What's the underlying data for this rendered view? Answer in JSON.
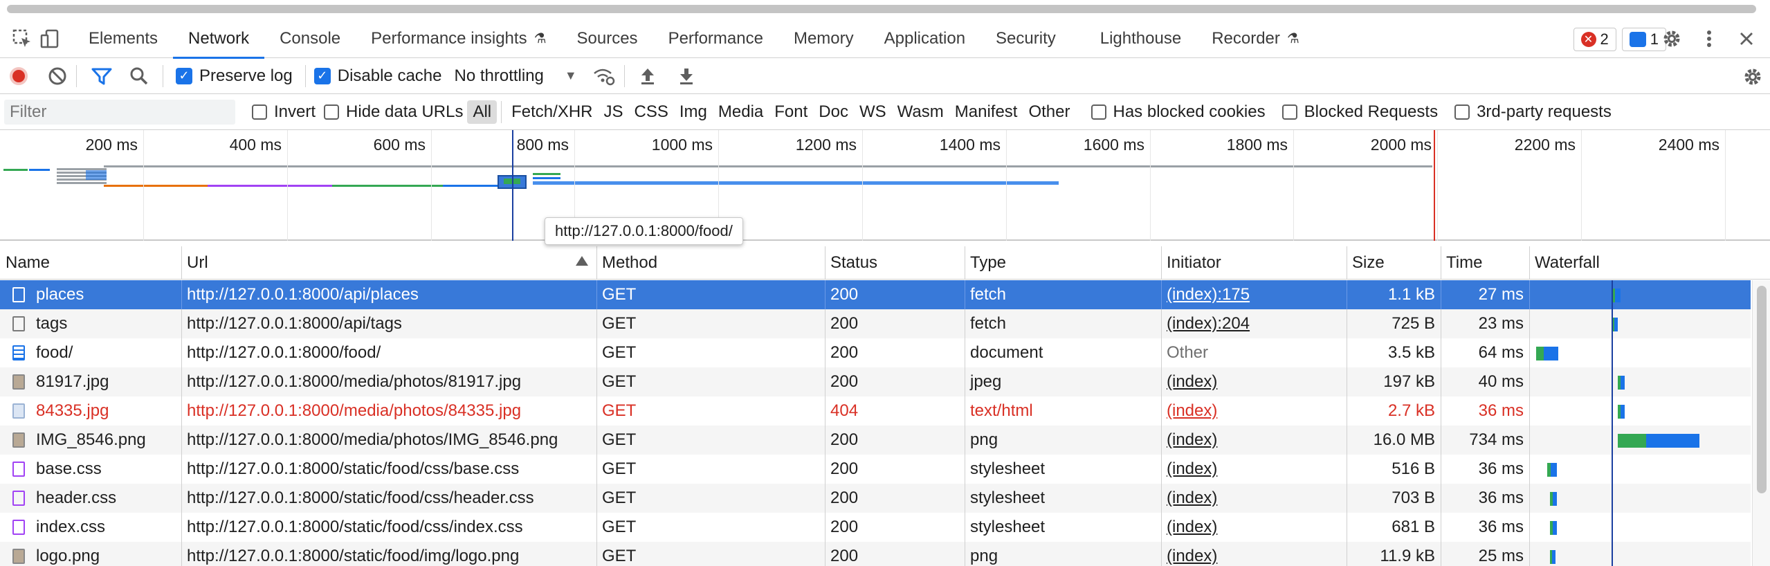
{
  "devtools_tabs": [
    {
      "label": "Elements"
    },
    {
      "label": "Network",
      "selected": true
    },
    {
      "label": "Console"
    },
    {
      "label": "Performance insights",
      "experimental": true
    },
    {
      "label": "Sources"
    },
    {
      "label": "Performance"
    },
    {
      "label": "Memory"
    },
    {
      "label": "Application"
    },
    {
      "label": "Security"
    },
    {
      "label": "Lighthouse"
    },
    {
      "label": "Recorder",
      "experimental": true
    }
  ],
  "badges": {
    "errors": "2",
    "messages": "1"
  },
  "toolbar": {
    "preserve_log_label": "Preserve log",
    "preserve_log_checked": true,
    "disable_cache_label": "Disable cache",
    "disable_cache_checked": true,
    "throttling_value": "No throttling"
  },
  "filter": {
    "placeholder": "Filter",
    "invert_label": "Invert",
    "hide_data_urls_label": "Hide data URLs",
    "types": [
      "All",
      "Fetch/XHR",
      "JS",
      "CSS",
      "Img",
      "Media",
      "Font",
      "Doc",
      "WS",
      "Wasm",
      "Manifest",
      "Other"
    ],
    "active_type": "All",
    "has_blocked_cookies_label": "Has blocked cookies",
    "blocked_requests_label": "Blocked Requests",
    "third_party_label": "3rd-party requests"
  },
  "overview": {
    "ticks": [
      "200 ms",
      "400 ms",
      "600 ms",
      "800 ms",
      "1000 ms",
      "1200 ms",
      "1400 ms",
      "1600 ms",
      "1800 ms",
      "2000 ms",
      "2200 ms",
      "2400 ms"
    ],
    "tooltip": "http://127.0.0.1:8000/food/"
  },
  "columns": {
    "name": "Name",
    "url": "Url",
    "method": "Method",
    "status": "Status",
    "type": "Type",
    "initiator": "Initiator",
    "size": "Size",
    "time": "Time",
    "waterfall": "Waterfall"
  },
  "requests": [
    {
      "name": "places",
      "url": "http://127.0.0.1:8000/api/places",
      "method": "GET",
      "status": "200",
      "type": "fetch",
      "initiator": "(index):175",
      "size": "1.1 kB",
      "time": "27 ms",
      "icon": "blank-file-icon",
      "selected": true
    },
    {
      "name": "tags",
      "url": "http://127.0.0.1:8000/api/tags",
      "method": "GET",
      "status": "200",
      "type": "fetch",
      "initiator": "(index):204",
      "size": "725 B",
      "time": "23 ms",
      "icon": "blank-file-icon"
    },
    {
      "name": "food/",
      "url": "http://127.0.0.1:8000/food/",
      "method": "GET",
      "status": "200",
      "type": "document",
      "initiator": "Other",
      "size": "3.5 kB",
      "time": "64 ms",
      "icon": "document-icon"
    },
    {
      "name": "81917.jpg",
      "url": "http://127.0.0.1:8000/media/photos/81917.jpg",
      "method": "GET",
      "status": "200",
      "type": "jpeg",
      "initiator": "(index)",
      "size": "197 kB",
      "time": "40 ms",
      "icon": "image-icon"
    },
    {
      "name": "84335.jpg",
      "url": "http://127.0.0.1:8000/media/photos/84335.jpg",
      "method": "GET",
      "status": "404",
      "type": "text/html",
      "initiator": "(index)",
      "size": "2.7 kB",
      "time": "36 ms",
      "icon": "broken-image-icon",
      "error": true
    },
    {
      "name": "IMG_8546.png",
      "url": "http://127.0.0.1:8000/media/photos/IMG_8546.png",
      "method": "GET",
      "status": "200",
      "type": "png",
      "initiator": "(index)",
      "size": "16.0 MB",
      "time": "734 ms",
      "icon": "image-icon"
    },
    {
      "name": "base.css",
      "url": "http://127.0.0.1:8000/static/food/css/base.css",
      "method": "GET",
      "status": "200",
      "type": "stylesheet",
      "initiator": "(index)",
      "size": "516 B",
      "time": "36 ms",
      "icon": "css-file-icon"
    },
    {
      "name": "header.css",
      "url": "http://127.0.0.1:8000/static/food/css/header.css",
      "method": "GET",
      "status": "200",
      "type": "stylesheet",
      "initiator": "(index)",
      "size": "703 B",
      "time": "36 ms",
      "icon": "css-file-icon"
    },
    {
      "name": "index.css",
      "url": "http://127.0.0.1:8000/static/food/css/index.css",
      "method": "GET",
      "status": "200",
      "type": "stylesheet",
      "initiator": "(index)",
      "size": "681 B",
      "time": "36 ms",
      "icon": "css-file-icon"
    },
    {
      "name": "logo.png",
      "url": "http://127.0.0.1:8000/static/food/img/logo.png",
      "method": "GET",
      "status": "200",
      "type": "png",
      "initiator": "(index)",
      "size": "11.9 kB",
      "time": "25 ms",
      "icon": "image-icon"
    }
  ],
  "colors": {
    "accent": "#1a73e8",
    "selected_row": "#3879d9",
    "error": "#d93025",
    "waiting": "#34a853",
    "download": "#1a73e8"
  }
}
